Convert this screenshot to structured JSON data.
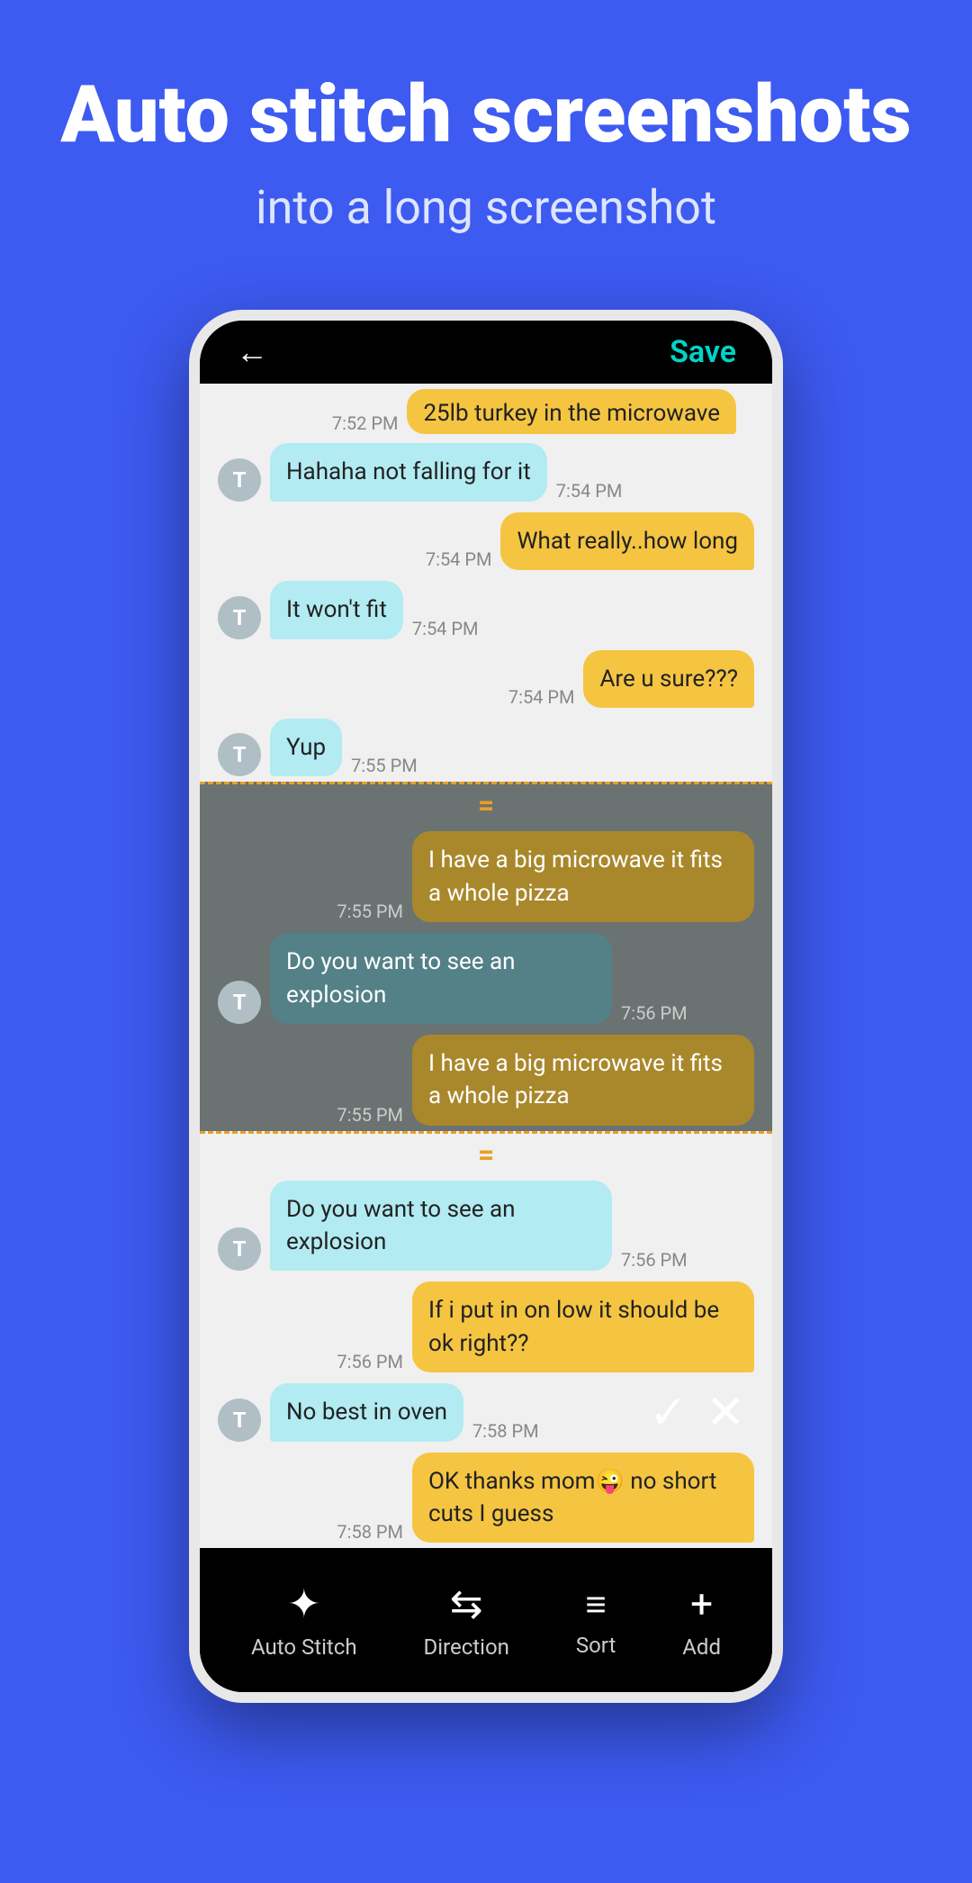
{
  "header": {
    "title": "Auto stitch screenshots",
    "subtitle": "into a long screenshot"
  },
  "phone": {
    "topbar": {
      "back_label": "←",
      "save_label": "Save"
    },
    "messages": [
      {
        "id": 1,
        "type": "sent",
        "text": "25lb turkey in the microwave",
        "time": "7:52 PM",
        "partial": true
      },
      {
        "id": 2,
        "type": "received",
        "text": "Hahaha not falling for it",
        "time": "7:54 PM"
      },
      {
        "id": 3,
        "type": "sent",
        "text": "What really..how long",
        "time": "7:54 PM"
      },
      {
        "id": 4,
        "type": "received",
        "text": "It won't fit",
        "time": "7:54 PM"
      },
      {
        "id": 5,
        "type": "sent",
        "text": "Are u sure???",
        "time": "7:54 PM"
      },
      {
        "id": 6,
        "type": "received",
        "text": "Yup",
        "time": "7:55 PM"
      },
      {
        "id": 7,
        "type": "sent",
        "text": "I have a big microwave it fits a whole pizza",
        "time": "7:55 PM",
        "overlap_start": true
      },
      {
        "id": 8,
        "type": "received",
        "text": "Do you want to see an explosion",
        "time": "7:56 PM",
        "overlap": true
      },
      {
        "id": 9,
        "type": "sent",
        "text": "I have a big microwave it fits a whole pizza",
        "time": "7:55 PM",
        "overlap_end": true
      },
      {
        "id": 10,
        "type": "received",
        "text": "Do you want to see an explosion",
        "time": "7:56 PM"
      },
      {
        "id": 11,
        "type": "sent",
        "text": "If i put in on low it should be ok right??",
        "time": "7:56 PM"
      },
      {
        "id": 12,
        "type": "received",
        "text": "No best in oven",
        "time": "7:58 PM"
      },
      {
        "id": 13,
        "type": "sent",
        "text": "OK thanks mom😜 no short cuts I guess",
        "time": "7:58 PM"
      }
    ],
    "toolbar": {
      "items": [
        {
          "id": "auto-stitch",
          "label": "Auto Stitch",
          "icon": "✦"
        },
        {
          "id": "direction",
          "label": "Direction",
          "icon": "⇆"
        },
        {
          "id": "sort",
          "label": "Sort",
          "icon": "≡"
        },
        {
          "id": "add",
          "label": "Add",
          "icon": "+"
        }
      ]
    }
  }
}
